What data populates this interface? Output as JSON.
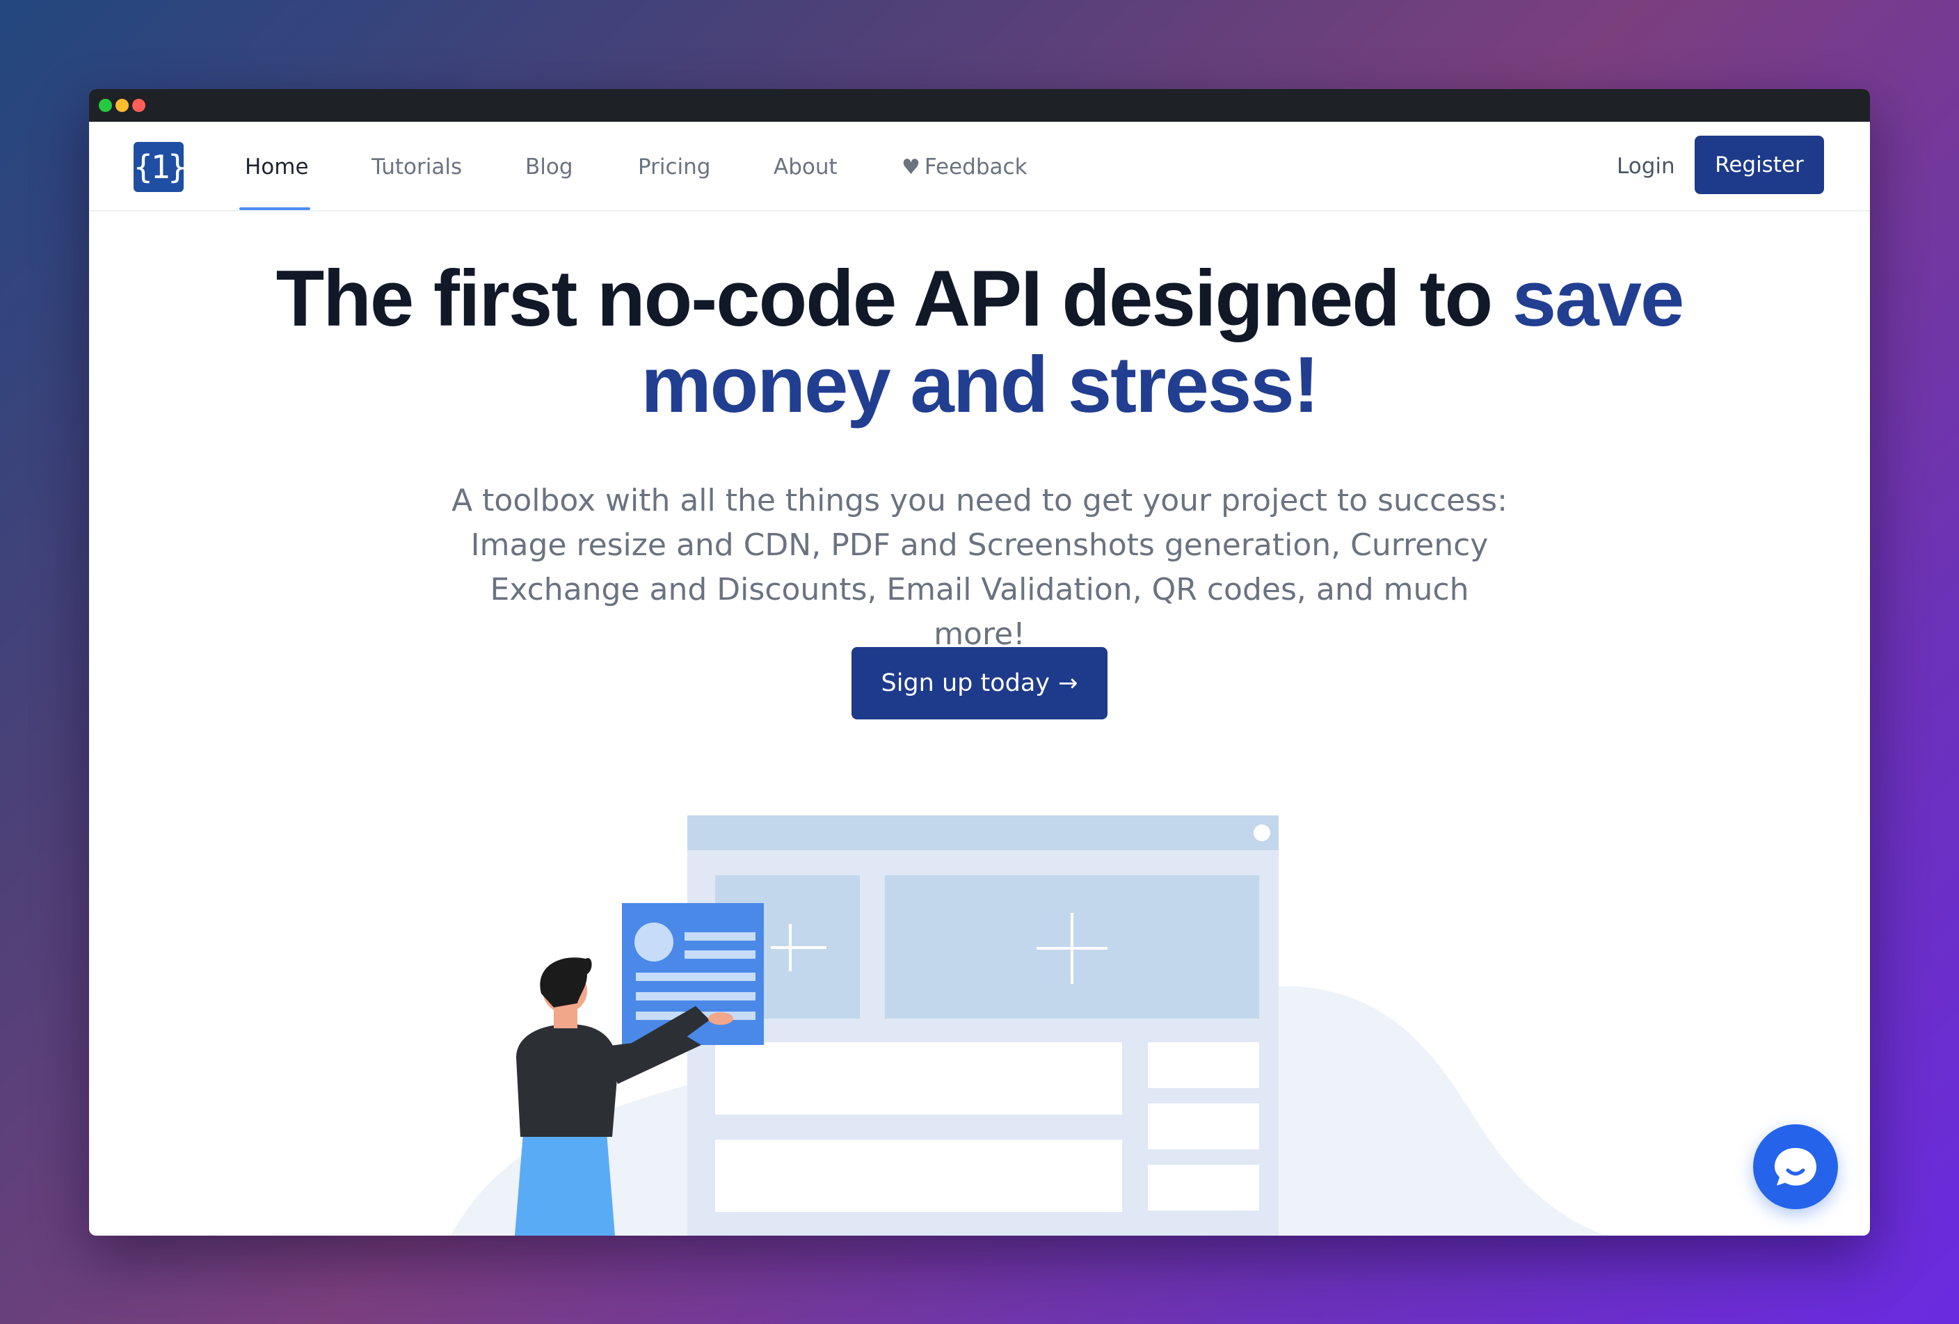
{
  "window": {
    "logo_text": "{1}"
  },
  "nav": {
    "items": [
      {
        "label": "Home",
        "active": true
      },
      {
        "label": "Tutorials"
      },
      {
        "label": "Blog"
      },
      {
        "label": "Pricing"
      },
      {
        "label": "About"
      },
      {
        "label": "Feedback",
        "icon": "heart-icon"
      }
    ],
    "login_label": "Login",
    "register_label": "Register"
  },
  "hero": {
    "title_main": "The first no-code API designed to ",
    "title_accent": "save money and stress!",
    "subtitle": "A toolbox with all the things you need to get your project to success: Image resize and CDN, PDF and Screenshots generation, Currency Exchange and Discounts, Email Validation, QR codes, and much more!",
    "cta_label": "Sign up today",
    "cta_icon": "arrow-right-icon"
  },
  "chat": {
    "icon": "chat-icon"
  },
  "colors": {
    "brand": "#1e3a8a",
    "accent_text": "#213e91",
    "active_underline": "#4d8cf5",
    "chat": "#2563eb"
  }
}
